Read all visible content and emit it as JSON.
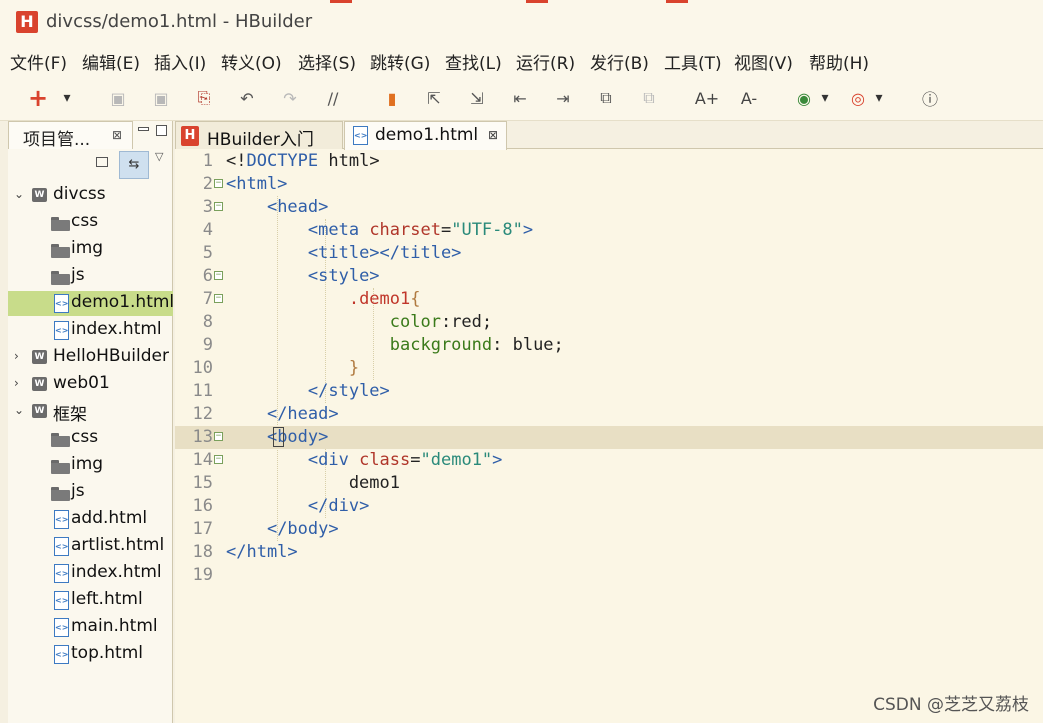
{
  "window": {
    "title": "divcss/demo1.html  -  HBuilder",
    "logo_letter": "H"
  },
  "menu": [
    "文件(F)",
    "编辑(E)",
    "插入(I)",
    "转义(O)",
    "选择(S)",
    "跳转(G)",
    "查找(L)",
    "运行(R)",
    "发行(B)",
    "工具(T)",
    "视图(V)",
    "帮助(H)"
  ],
  "toolbar": [
    {
      "name": "new-icon",
      "glyph": "+",
      "color": "#d9432e"
    },
    {
      "name": "dropdown-arrow-icon",
      "glyph": "▾",
      "color": "#333"
    },
    {
      "name": "save-icon",
      "glyph": "▣",
      "color": "#b8b8b8"
    },
    {
      "name": "save-all-icon",
      "glyph": "▣",
      "color": "#b8b8b8"
    },
    {
      "name": "format-icon",
      "glyph": "⎘",
      "color": "#b0362a"
    },
    {
      "name": "undo-icon",
      "glyph": "↶",
      "color": "#555"
    },
    {
      "name": "redo-icon",
      "glyph": "↷",
      "color": "#b8b8b8"
    },
    {
      "name": "comment-icon",
      "glyph": "//",
      "color": "#555"
    },
    {
      "name": "bookmark-icon",
      "glyph": "▮",
      "color": "#e07020"
    },
    {
      "name": "goto-top-icon",
      "glyph": "⇱",
      "color": "#555"
    },
    {
      "name": "goto-bottom-icon",
      "glyph": "⇲",
      "color": "#555"
    },
    {
      "name": "indent-left-icon",
      "glyph": "⇤",
      "color": "#555"
    },
    {
      "name": "indent-right-icon",
      "glyph": "⇥",
      "color": "#555"
    },
    {
      "name": "copy-icon",
      "glyph": "⧉",
      "color": "#555"
    },
    {
      "name": "paste-icon",
      "glyph": "⧉",
      "color": "#b8b8b8"
    },
    {
      "name": "font-increase-icon",
      "glyph": "A+",
      "color": "#444"
    },
    {
      "name": "font-decrease-icon",
      "glyph": "A-",
      "color": "#444"
    },
    {
      "name": "run-icon",
      "glyph": "◉",
      "color": "#3a8a3a"
    },
    {
      "name": "run-dropdown-icon",
      "glyph": "▾",
      "color": "#333"
    },
    {
      "name": "browser-icon",
      "glyph": "◎",
      "color": "#d9432e"
    },
    {
      "name": "browser-dropdown-icon",
      "glyph": "▾",
      "color": "#333"
    },
    {
      "name": "info-icon",
      "glyph": "ⓘ",
      "color": "#444"
    }
  ],
  "left_panel": {
    "tab_label": "项目管...",
    "close_glyph": "⊠",
    "tree": [
      {
        "type": "project",
        "label": "divcss",
        "expanded": true,
        "depth": 0
      },
      {
        "type": "folder",
        "label": "css",
        "depth": 1
      },
      {
        "type": "folder",
        "label": "img",
        "depth": 1
      },
      {
        "type": "folder",
        "label": "js",
        "depth": 1
      },
      {
        "type": "file",
        "label": "demo1.html",
        "depth": 1,
        "selected": true
      },
      {
        "type": "file",
        "label": "index.html",
        "depth": 1
      },
      {
        "type": "project",
        "label": "HelloHBuilder",
        "expanded": false,
        "depth": 0
      },
      {
        "type": "project",
        "label": "web01",
        "expanded": false,
        "depth": 0
      },
      {
        "type": "project",
        "label": "框架",
        "expanded": true,
        "depth": 0
      },
      {
        "type": "folder",
        "label": "css",
        "depth": 1
      },
      {
        "type": "folder",
        "label": "img",
        "depth": 1
      },
      {
        "type": "folder",
        "label": "js",
        "depth": 1
      },
      {
        "type": "file",
        "label": "add.html",
        "depth": 1
      },
      {
        "type": "file",
        "label": "artlist.html",
        "depth": 1
      },
      {
        "type": "file",
        "label": "index.html",
        "depth": 1
      },
      {
        "type": "file",
        "label": "left.html",
        "depth": 1
      },
      {
        "type": "file",
        "label": "main.html",
        "depth": 1
      },
      {
        "type": "file",
        "label": "top.html",
        "depth": 1
      }
    ]
  },
  "editor": {
    "tabs": [
      {
        "label": "HBuilder入门",
        "active": false
      },
      {
        "label": "demo1.html",
        "active": true
      }
    ],
    "current_line": 13,
    "lines": [
      {
        "n": "1",
        "fold": false,
        "tokens": [
          [
            "t-plain",
            "<!"
          ],
          [
            "t-tag",
            "DOCTYPE"
          ],
          [
            "t-plain",
            " html>"
          ]
        ]
      },
      {
        "n": "2",
        "fold": true,
        "tokens": [
          [
            "t-tag",
            "<html>"
          ]
        ]
      },
      {
        "n": "3",
        "fold": true,
        "tokens": [
          [
            "t-plain",
            "    "
          ],
          [
            "t-tag",
            "<head>"
          ]
        ]
      },
      {
        "n": "4",
        "fold": false,
        "tokens": [
          [
            "t-plain",
            "        "
          ],
          [
            "t-tag",
            "<meta "
          ],
          [
            "t-attr",
            "charset"
          ],
          [
            "t-plain",
            "="
          ],
          [
            "t-str",
            "\"UTF-8\""
          ],
          [
            "t-tag",
            ">"
          ]
        ]
      },
      {
        "n": "5",
        "fold": false,
        "tokens": [
          [
            "t-plain",
            "        "
          ],
          [
            "t-tag",
            "<title></title>"
          ]
        ]
      },
      {
        "n": "6",
        "fold": true,
        "tokens": [
          [
            "t-plain",
            "        "
          ],
          [
            "t-tag",
            "<style>"
          ]
        ]
      },
      {
        "n": "7",
        "fold": true,
        "tokens": [
          [
            "t-plain",
            "            "
          ],
          [
            "t-sel",
            ".demo1"
          ],
          [
            "t-brace",
            "{"
          ]
        ]
      },
      {
        "n": "8",
        "fold": false,
        "tokens": [
          [
            "t-plain",
            "                "
          ],
          [
            "t-prop",
            "color"
          ],
          [
            "t-plain",
            ":red;"
          ]
        ]
      },
      {
        "n": "9",
        "fold": false,
        "tokens": [
          [
            "t-plain",
            "                "
          ],
          [
            "t-prop",
            "background"
          ],
          [
            "t-plain",
            ": blue;"
          ]
        ]
      },
      {
        "n": "10",
        "fold": false,
        "tokens": [
          [
            "t-plain",
            "            "
          ],
          [
            "t-brace",
            "}"
          ]
        ]
      },
      {
        "n": "11",
        "fold": false,
        "tokens": [
          [
            "t-plain",
            "        "
          ],
          [
            "t-tag",
            "</style>"
          ]
        ]
      },
      {
        "n": "12",
        "fold": false,
        "tokens": [
          [
            "t-plain",
            "    "
          ],
          [
            "t-tag",
            "</head>"
          ]
        ]
      },
      {
        "n": "13",
        "fold": true,
        "tokens": [
          [
            "t-plain",
            "    "
          ],
          [
            "t-tag",
            "<body>"
          ]
        ]
      },
      {
        "n": "14",
        "fold": true,
        "tokens": [
          [
            "t-plain",
            "        "
          ],
          [
            "t-tag",
            "<div "
          ],
          [
            "t-attr",
            "class"
          ],
          [
            "t-plain",
            "="
          ],
          [
            "t-str",
            "\"demo1\""
          ],
          [
            "t-tag",
            ">"
          ]
        ]
      },
      {
        "n": "15",
        "fold": false,
        "tokens": [
          [
            "t-plain",
            "            demo1"
          ]
        ]
      },
      {
        "n": "16",
        "fold": false,
        "tokens": [
          [
            "t-plain",
            "        "
          ],
          [
            "t-tag",
            "</div>"
          ]
        ]
      },
      {
        "n": "17",
        "fold": false,
        "tokens": [
          [
            "t-plain",
            "    "
          ],
          [
            "t-tag",
            "</body>"
          ]
        ]
      },
      {
        "n": "18",
        "fold": false,
        "tokens": [
          [
            "t-tag",
            "</html>"
          ]
        ]
      },
      {
        "n": "19",
        "fold": false,
        "tokens": []
      }
    ]
  },
  "watermark": "CSDN @芝芝又荔枝"
}
